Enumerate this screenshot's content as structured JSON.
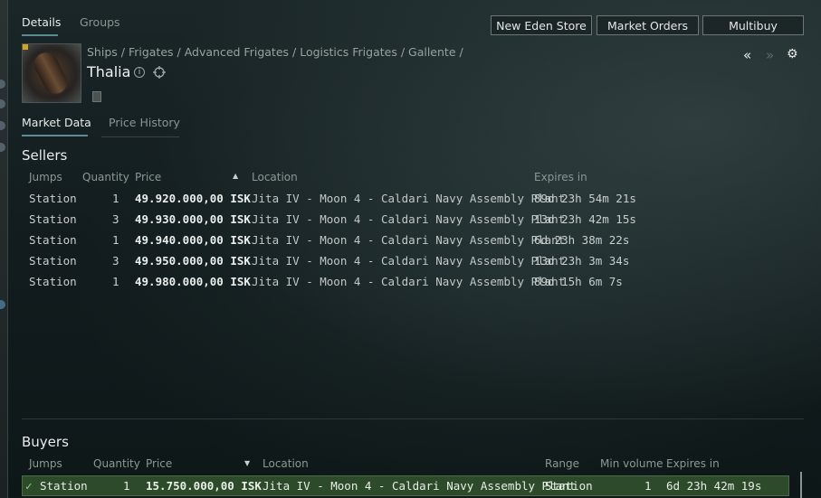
{
  "tabs": {
    "details": "Details",
    "groups": "Groups"
  },
  "header_buttons": {
    "store": "New Eden Store",
    "orders": "Market Orders",
    "multibuy": "Multibuy"
  },
  "item": {
    "breadcrumb": [
      "Ships",
      "Frigates",
      "Advanced Frigates",
      "Logistics Frigates",
      "Gallente"
    ],
    "name": "Thalia",
    "info_icon": "i"
  },
  "nav_icons": {
    "back": "«",
    "forward": "»",
    "settings": "⚙"
  },
  "subtabs": {
    "market_data": "Market Data",
    "price_history": "Price History"
  },
  "sellers": {
    "title": "Sellers",
    "columns": {
      "jumps": "Jumps",
      "quantity": "Quantity",
      "price": "Price",
      "location": "Location",
      "expires": "Expires in"
    },
    "sort_indicator": "▲",
    "rows": [
      {
        "jumps": "Station",
        "quantity": "1",
        "price": "49.920.000,00 ISK",
        "location": "Jita IV - Moon 4 - Caldari Navy Assembly Plant",
        "expires": "89d 23h 54m 21s"
      },
      {
        "jumps": "Station",
        "quantity": "3",
        "price": "49.930.000,00 ISK",
        "location": "Jita IV - Moon 4 - Caldari Navy Assembly Plant",
        "expires": "13d 23h 42m 15s"
      },
      {
        "jumps": "Station",
        "quantity": "1",
        "price": "49.940.000,00 ISK",
        "location": "Jita IV - Moon 4 - Caldari Navy Assembly Plant",
        "expires": "6d 23h 38m 22s"
      },
      {
        "jumps": "Station",
        "quantity": "3",
        "price": "49.950.000,00 ISK",
        "location": "Jita IV - Moon 4 - Caldari Navy Assembly Plant",
        "expires": "13d 23h 3m 34s"
      },
      {
        "jumps": "Station",
        "quantity": "1",
        "price": "49.980.000,00 ISK",
        "location": "Jita IV - Moon 4 - Caldari Navy Assembly Plant",
        "expires": "89d 15h 6m 7s"
      }
    ]
  },
  "buyers": {
    "title": "Buyers",
    "columns": {
      "jumps": "Jumps",
      "quantity": "Quantity",
      "price": "Price",
      "location": "Location",
      "range": "Range",
      "min_volume": "Min volume",
      "expires": "Expires in"
    },
    "sort_indicator": "▼",
    "rows": [
      {
        "check": "✓",
        "jumps": "Station",
        "quantity": "1",
        "price": "15.750.000,00 ISK",
        "location": "Jita IV - Moon 4 - Caldari Navy Assembly Plant",
        "range": "Station",
        "min_volume": "1",
        "expires": "6d 23h 42m 19s"
      }
    ]
  },
  "colors": {
    "accent": "#5d8b93",
    "buyer_highlight": "#2d4a2a",
    "gold_badge": "#d4a323"
  }
}
